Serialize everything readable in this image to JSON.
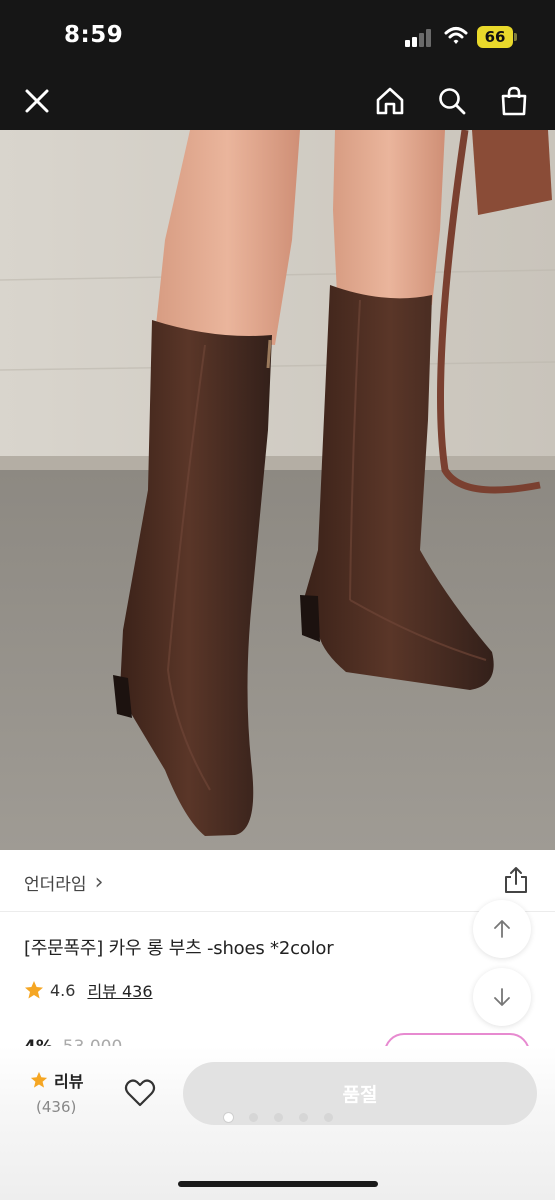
{
  "status_bar": {
    "time": "8:59",
    "battery": "66",
    "icons": [
      "signal-icon",
      "wifi-icon",
      "battery-icon"
    ]
  },
  "app_bar": {
    "icons": [
      "close-icon",
      "home-icon",
      "search-icon",
      "shopping-bag-icon"
    ]
  },
  "product": {
    "image": "brown knee-high square-toe leather boots on model",
    "brand": "언더라임",
    "brand_chevron": "›",
    "title": "[주문폭주] 카우 롱 부츠 -shoes *2color",
    "rating": "4.6",
    "review_link": "리뷰 436",
    "discount": "4%",
    "original_price": "53,000"
  },
  "bottom_bar": {
    "review_label": "리뷰",
    "review_count": "(436)",
    "buy_button": "품절",
    "carousel_dots": 5,
    "active_dot": 0
  },
  "colors": {
    "header_bg": "#161616",
    "battery": "#e9d92b",
    "star": "#f5a623",
    "button_disabled": "#e2e2e2",
    "pink_accent": "#e78ad0"
  }
}
